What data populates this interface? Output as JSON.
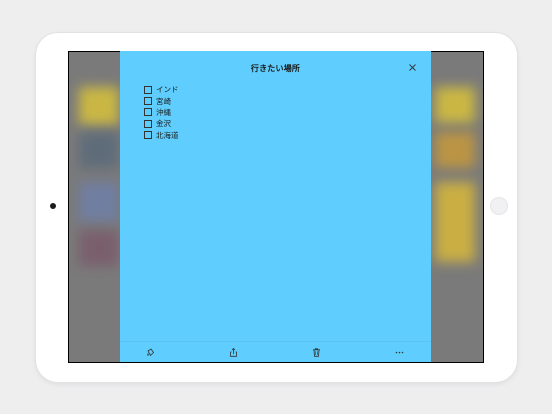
{
  "note": {
    "title": "行きたい場所",
    "items": [
      {
        "label": "インド",
        "checked": false
      },
      {
        "label": "宮崎",
        "checked": false
      },
      {
        "label": "沖縄",
        "checked": false
      },
      {
        "label": "金沢",
        "checked": false
      },
      {
        "label": "北海道",
        "checked": false
      }
    ],
    "background_color": "#5fcdfd"
  },
  "toolbar": {
    "icons": [
      "color-picker-icon",
      "share-icon",
      "trash-icon",
      "more-icon"
    ]
  }
}
